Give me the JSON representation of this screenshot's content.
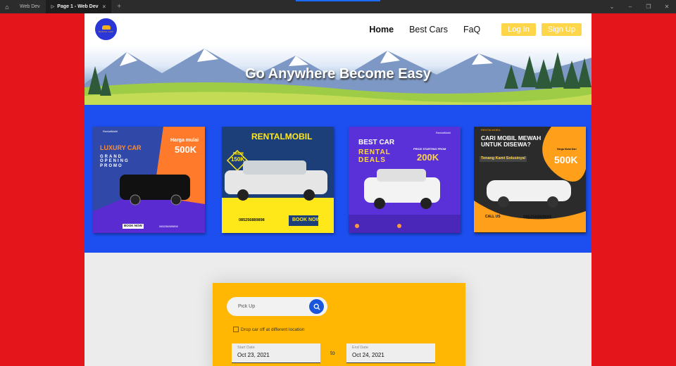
{
  "window": {
    "tabs": [
      {
        "label": "Web Dev"
      },
      {
        "label": "Page 1 - Web Dev"
      }
    ],
    "progress": 1.0
  },
  "nav": {
    "links": [
      "Home",
      "Best Cars",
      "FaQ"
    ],
    "login_label": "Log In",
    "signup_label": "Sign Up",
    "logo_text": "RENTAL CAR"
  },
  "hero": {
    "title": "Go Anywhere Become Easy"
  },
  "promos": [
    {
      "brand": "RentalMobil",
      "headline": "LUXURY CAR",
      "sub": "GRAND OPENING PROMO",
      "price_label": "Harga mulai",
      "price": "500K",
      "cta": "BOOK NOW",
      "phone": "085256889898"
    },
    {
      "headline": "RENTALMOBIL",
      "from_label": "FROM",
      "price": "150K",
      "cta": "BOOK NOW",
      "phone": "085256889898"
    },
    {
      "brand": "RentalMobil",
      "headline": "BEST CAR",
      "sub": "RENTAL DEALS",
      "price_label": "PRICE STARTING FROM",
      "price": "200K"
    },
    {
      "brand": "RENTALMOBIL",
      "headline": "CARI MOBIL MEWAH UNTUK DISEWA?",
      "sub": "Tenang Kami Solusinya!",
      "price_label": "Harga Mulai Dari",
      "price": "500K",
      "cta": "CALL US",
      "phone": "085256889898"
    }
  ],
  "booking": {
    "pickup_placeholder": "Pick Up",
    "dropoff_label": "Drop car off at different location",
    "start_label": "Start Date",
    "start_value": "Oct 23, 2021",
    "to_label": "to",
    "end_label": "End Date",
    "end_value": "Oct 24, 2021"
  },
  "colors": {
    "background": "#e4161b",
    "band": "#1d4ff0",
    "accent": "#ffd54a",
    "booking": "#ffb703",
    "search": "#1a56db"
  }
}
